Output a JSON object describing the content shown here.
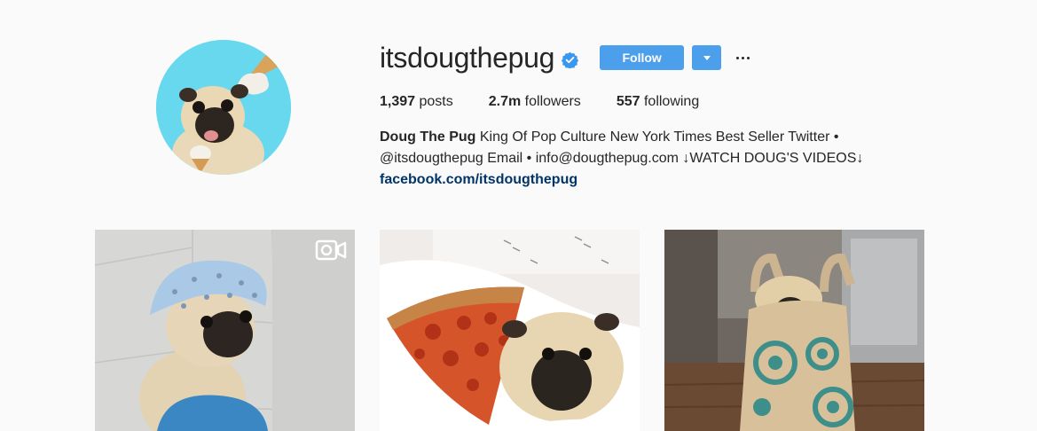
{
  "profile": {
    "username": "itsdougthepug",
    "verified": true,
    "follow_label": "Follow",
    "accent_color": "#4c9fea",
    "stats": {
      "posts_count": "1,397",
      "posts_label": "posts",
      "followers_count": "2.7m",
      "followers_label": "followers",
      "following_count": "557",
      "following_label": "following"
    },
    "bio": {
      "full_name": "Doug The Pug",
      "line1": " King Of Pop Culture New York Times Best Seller Twitter •",
      "line2": "@itsdougthepug Email • info@dougthepug.com ↓WATCH DOUG'S VIDEOS↓",
      "link": "facebook.com/itsdougthepug"
    }
  },
  "posts": [
    {
      "subject": "pug wearing shower cap",
      "is_video": true,
      "video_icon": "video-camera-icon"
    },
    {
      "subject": "pug with pizza slice on pillow",
      "is_video": false
    },
    {
      "subject": "pug inside paper shopping bag",
      "is_video": false
    }
  ]
}
